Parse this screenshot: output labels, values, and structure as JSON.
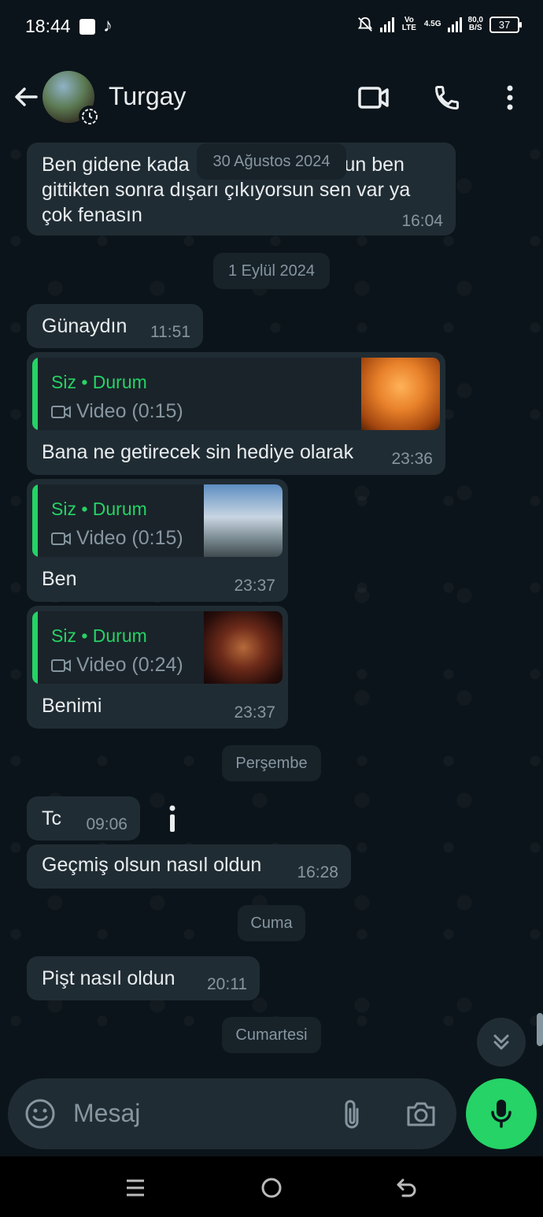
{
  "status": {
    "time": "18:44",
    "net": "Vo LTE",
    "net2": "4.5G",
    "speed": "80,0",
    "speed_unit": "B/S",
    "battery": "37"
  },
  "header": {
    "contact_name": "Turgay"
  },
  "messages": {
    "m1": {
      "text": "Ben gidene kada",
      "text_cont": "sun ben",
      "line2": "gittikten sonra dışarı çıkıyorsun sen var ya",
      "line3": "çok fenasın",
      "time": "16:04"
    },
    "date1": "30 Ağustos 2024",
    "date2": "1 Eylül 2024",
    "m2": {
      "text": "Günaydın",
      "time": "11:51"
    },
    "m3": {
      "quote_who": "Siz • Durum",
      "quote_video": "Video (0:15)",
      "text": "Bana ne getirecek sin hediye olarak",
      "time": "23:36"
    },
    "m4": {
      "quote_who": "Siz • Durum",
      "quote_video": "Video (0:15)",
      "text": "Ben",
      "time": "23:37"
    },
    "m5": {
      "quote_who": "Siz • Durum",
      "quote_video": "Video (0:24)",
      "text": "Benimi",
      "time": "23:37"
    },
    "date3": "Perşembe",
    "m6": {
      "text": "Tc",
      "time": "09:06"
    },
    "m7": {
      "text": "Geçmiş olsun nasıl oldun",
      "time": "16:28"
    },
    "date4": "Cuma",
    "m8": {
      "text": "Pişt nasıl oldun",
      "time": "20:11"
    },
    "date5": "Cumartesi"
  },
  "composer": {
    "placeholder": "Mesaj"
  },
  "colors": {
    "accent": "#25d366",
    "bubble": "#202c33",
    "background": "#0b141a"
  },
  "icons": [
    "back-arrow-icon",
    "video-call-icon",
    "phone-icon",
    "more-vert-icon",
    "emoji-icon",
    "attach-icon",
    "camera-icon",
    "mic-icon",
    "scroll-down-icon",
    "video-icon",
    "menu-nav-icon",
    "home-nav-icon",
    "back-nav-icon"
  ]
}
